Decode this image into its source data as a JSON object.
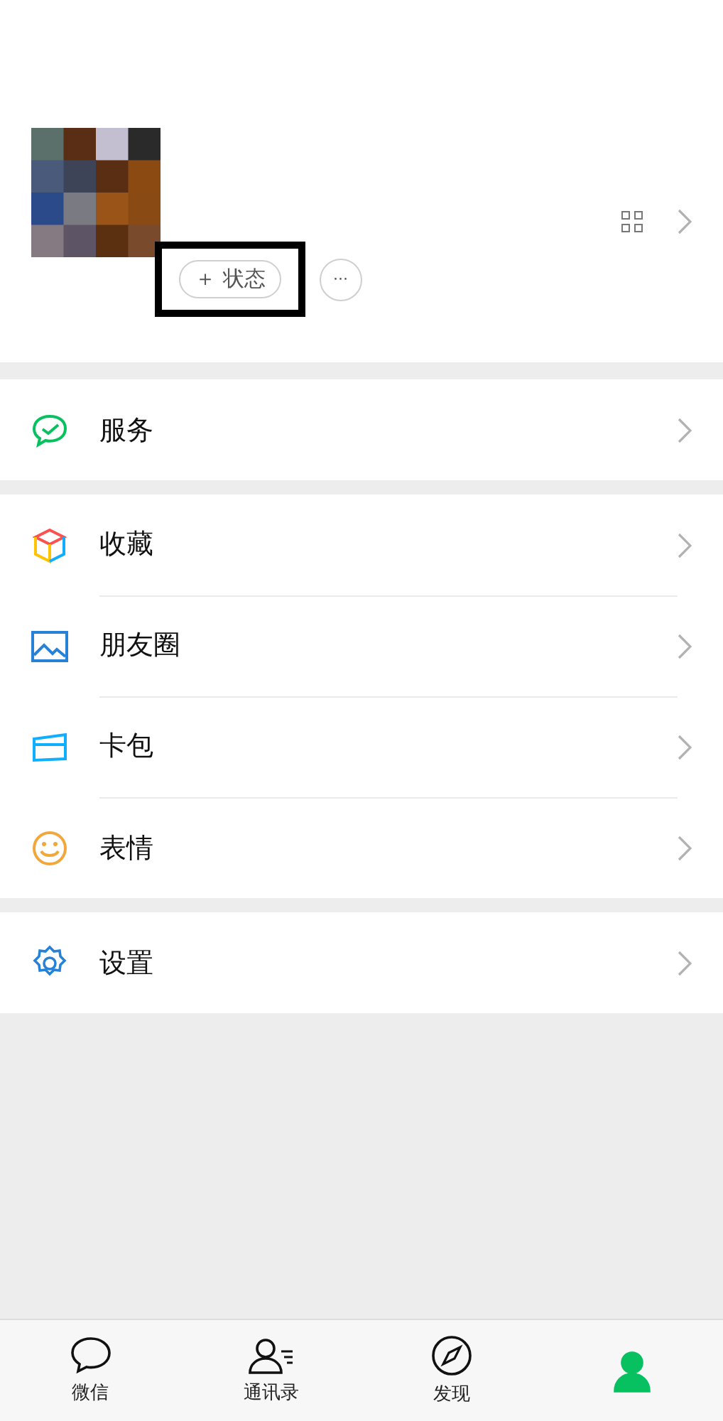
{
  "profile": {
    "status_button": "＋ 状态",
    "more_button": "···",
    "highlighted": true
  },
  "groups": [
    {
      "items": [
        {
          "kind": "pay",
          "label": "服务"
        }
      ]
    },
    {
      "items": [
        {
          "kind": "cube",
          "label": "收藏"
        },
        {
          "label": "朋友圈"
        },
        {
          "kind": "card",
          "label": "卡包"
        },
        {
          "kind": "smile",
          "label": "表情"
        }
      ]
    },
    {
      "items": [
        {
          "kind": "gear",
          "label": "设置"
        }
      ]
    }
  ],
  "tabs": [
    {
      "kind": "chat",
      "label": "微信",
      "selected": false
    },
    {
      "kind": "contacts",
      "label": "通讯录",
      "selected": false
    },
    {
      "kind": "compass",
      "label": "发现",
      "selected": false
    },
    {
      "kind": "me",
      "selected": true
    }
  ]
}
